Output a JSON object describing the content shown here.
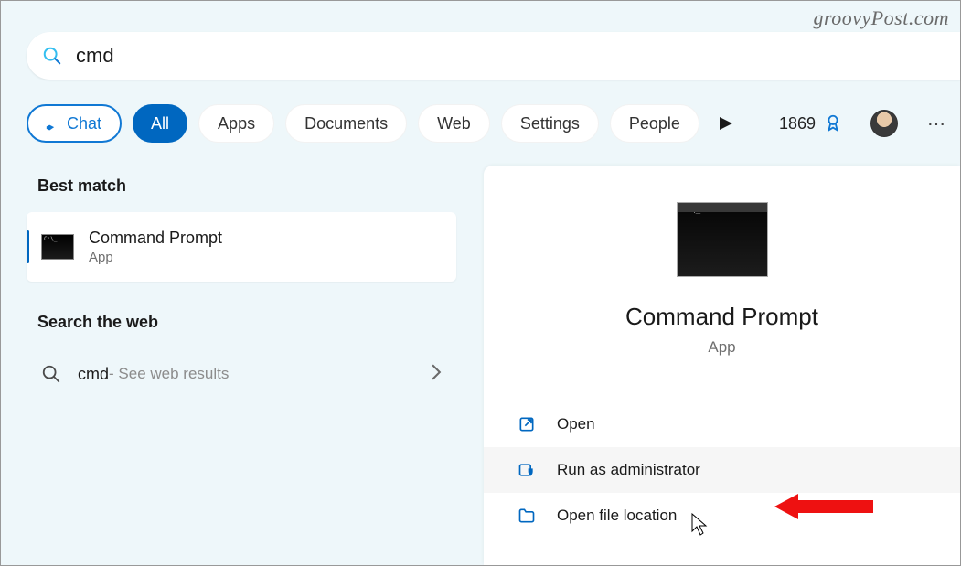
{
  "watermark": "groovyPost.com",
  "search": {
    "query": "cmd"
  },
  "filters": {
    "chat": "Chat",
    "all": "All",
    "apps": "Apps",
    "documents": "Documents",
    "web": "Web",
    "settings": "Settings",
    "people": "People"
  },
  "rewards_points": "1869",
  "left": {
    "best_match_heading": "Best match",
    "result": {
      "title": "Command Prompt",
      "subtitle": "App"
    },
    "search_web_heading": "Search the web",
    "web_result": {
      "term": "cmd",
      "hint": " - See web results"
    }
  },
  "detail": {
    "title": "Command Prompt",
    "subtitle": "App",
    "actions": {
      "open": "Open",
      "run_admin": "Run as administrator",
      "open_location": "Open file location"
    }
  }
}
